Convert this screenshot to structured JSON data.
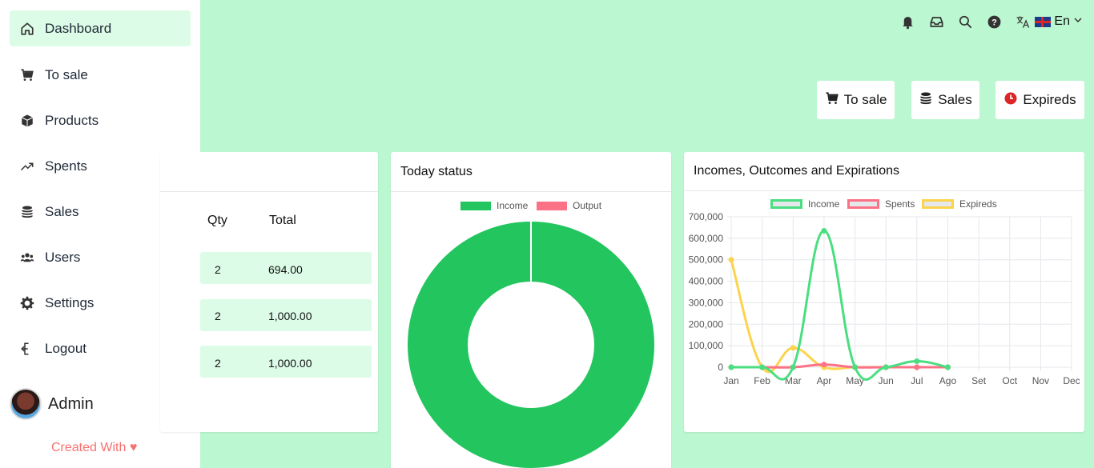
{
  "sidebar": {
    "items": [
      {
        "label": "Dashboard",
        "icon": "home-icon"
      },
      {
        "label": "To sale",
        "icon": "cart-icon"
      },
      {
        "label": "Products",
        "icon": "box-icon"
      },
      {
        "label": "Spents",
        "icon": "trend-icon"
      },
      {
        "label": "Sales",
        "icon": "database-icon"
      },
      {
        "label": "Users",
        "icon": "users-icon"
      },
      {
        "label": "Settings",
        "icon": "gear-icon"
      },
      {
        "label": "Logout",
        "icon": "logout-icon"
      }
    ],
    "user": "Admin",
    "credit": "Created With ♥"
  },
  "topbar": {
    "language": "En"
  },
  "quick": {
    "to_sale": "To sale",
    "sales": "Sales",
    "expireds": "Expireds"
  },
  "table": {
    "headers": {
      "qty": "Qty",
      "total": "Total"
    },
    "rows": [
      {
        "qty": "2",
        "total": "694.00"
      },
      {
        "qty": "2",
        "total": "1,000.00"
      },
      {
        "qty": "2",
        "total": "1,000.00"
      }
    ]
  },
  "today": {
    "title": "Today status"
  },
  "incomes": {
    "title": "Incomes, Outcomes and Expirations"
  },
  "colors": {
    "accent": "#22c55e",
    "income": "#22c55e",
    "output": "#fb7185",
    "expired": "#fcd34d",
    "background": "#bbf7d0"
  },
  "chart_data": [
    {
      "type": "pie",
      "title": "Today status",
      "legend": [
        "Income",
        "Output"
      ],
      "values": [
        1,
        0
      ],
      "colors": [
        "#22c55e",
        "#fb7185"
      ]
    },
    {
      "type": "line",
      "title": "Incomes, Outcomes and Expirations",
      "categories": [
        "Jan",
        "Feb",
        "Mar",
        "Apr",
        "May",
        "Jun",
        "Jul",
        "Ago",
        "Set",
        "Oct",
        "Nov",
        "Dec"
      ],
      "ylim": [
        0,
        700000
      ],
      "yticks": [
        "700,000",
        "600,000",
        "500,000",
        "400,000",
        "300,000",
        "200,000",
        "100,000",
        "0"
      ],
      "series": [
        {
          "name": "Income",
          "color": "#4ade80",
          "values": [
            0,
            0,
            0,
            635000,
            0,
            0,
            28000,
            0
          ]
        },
        {
          "name": "Spents",
          "color": "#fb7185",
          "values": [
            0,
            0,
            0,
            12000,
            0,
            0,
            0,
            0
          ]
        },
        {
          "name": "Expireds",
          "color": "#fcd34d",
          "values": [
            500000,
            0,
            90000,
            0,
            0,
            0,
            0,
            0
          ]
        }
      ],
      "grid": true,
      "legend": "top"
    }
  ]
}
